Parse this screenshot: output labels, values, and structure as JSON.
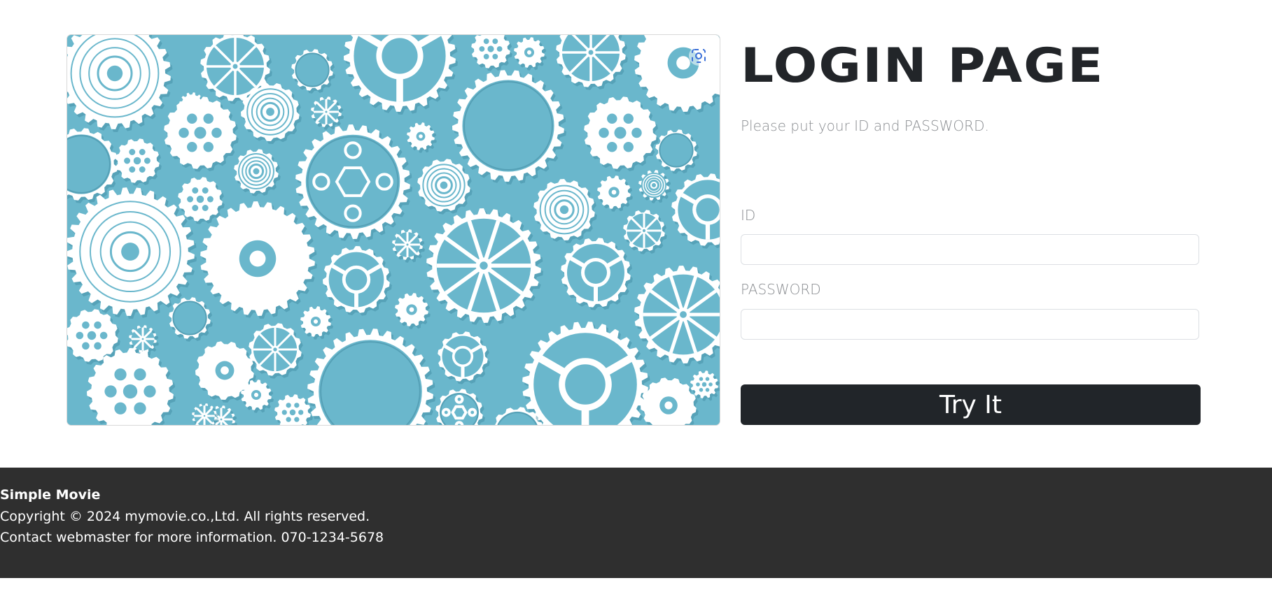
{
  "login": {
    "title": "LOGIN PAGE",
    "subtitle": "Please put your ID and PASSWORD.",
    "id_label": "ID",
    "id_value": "",
    "password_label": "PASSWORD",
    "password_value": "",
    "submit_label": "Try It"
  },
  "footer": {
    "brand": "Simple Movie",
    "copyright": "Copyright © 2024 mymovie.co.,Ltd. All rights reserved.",
    "contact": "Contact webmaster for more information. 070-1234-5678"
  },
  "colors": {
    "image_background": "#6ab7cc",
    "gear": "#ffffff",
    "button": "#212529",
    "footer": "#2f2f2f"
  },
  "icons": {
    "hero": "gears-image",
    "corner": "screenshot-scan-icon"
  }
}
